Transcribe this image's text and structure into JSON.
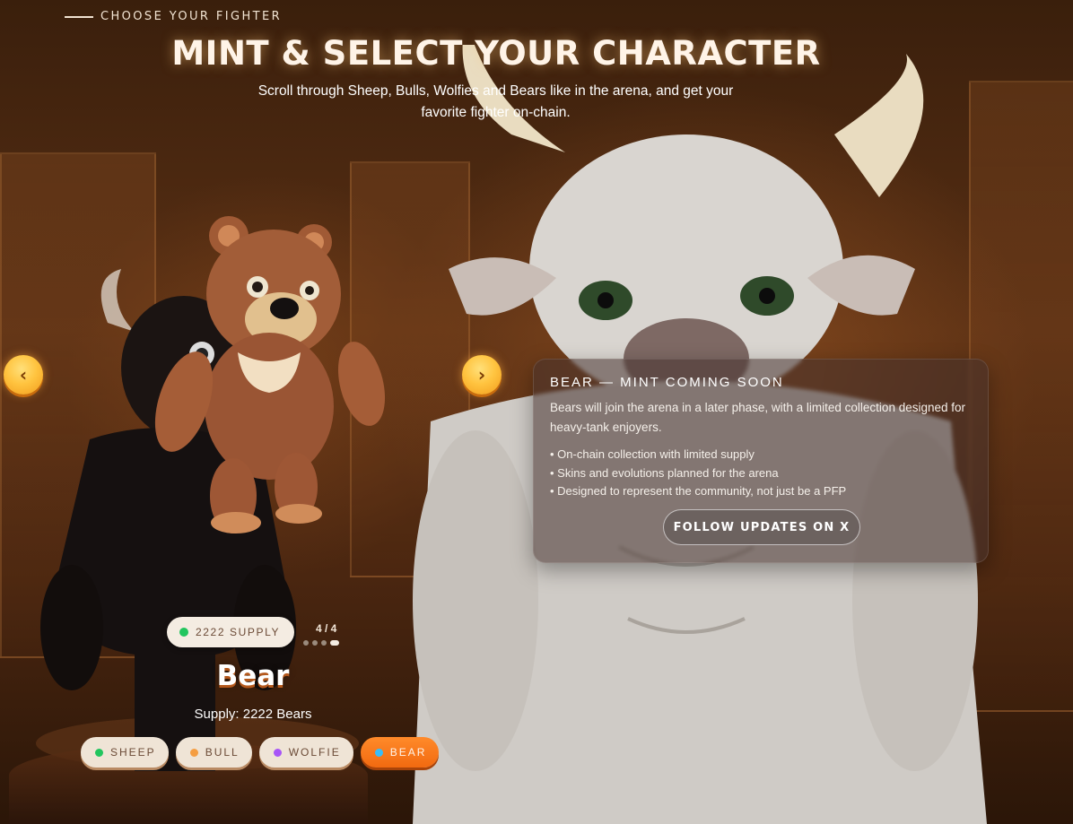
{
  "header": {
    "eyebrow": "CHOOSE YOUR FIGHTER",
    "title": "MINT & SELECT YOUR CHARACTER",
    "subtitle": "Scroll through Sheep, Bulls, Wolfies and Bears like in the arena, and get your favorite fighter on-chain."
  },
  "carousel": {
    "prev_icon": "‹",
    "next_icon": "›",
    "supply_badge": "2222 SUPPLY",
    "supply_dot_color": "#22c55e",
    "counter": "4 / 4",
    "page_count": 4,
    "active_page": 4,
    "character_name": "Bear",
    "character_supply": "Supply: 2222 Bears"
  },
  "tabs": [
    {
      "label": "SHEEP",
      "dot_color": "#22c55e",
      "active": false
    },
    {
      "label": "BULL",
      "dot_color": "#f59e42",
      "active": false
    },
    {
      "label": "WOLFIE",
      "dot_color": "#a855f7",
      "active": false
    },
    {
      "label": "BEAR",
      "dot_color": "#38bdf8",
      "active": true
    }
  ],
  "panel": {
    "title": "BEAR — MINT COMING SOON",
    "description": "Bears will join the arena in a later phase, with a limited collection designed for heavy-tank enjoyers.",
    "features": [
      "On-chain collection with limited supply",
      "Skins and evolutions planned for the arena",
      "Designed to represent the community, not just be a PFP"
    ],
    "button_label": "FOLLOW UPDATES ON X"
  },
  "colors": {
    "accent_orange": "#f26a10",
    "nav_gold": "#ffc440"
  }
}
